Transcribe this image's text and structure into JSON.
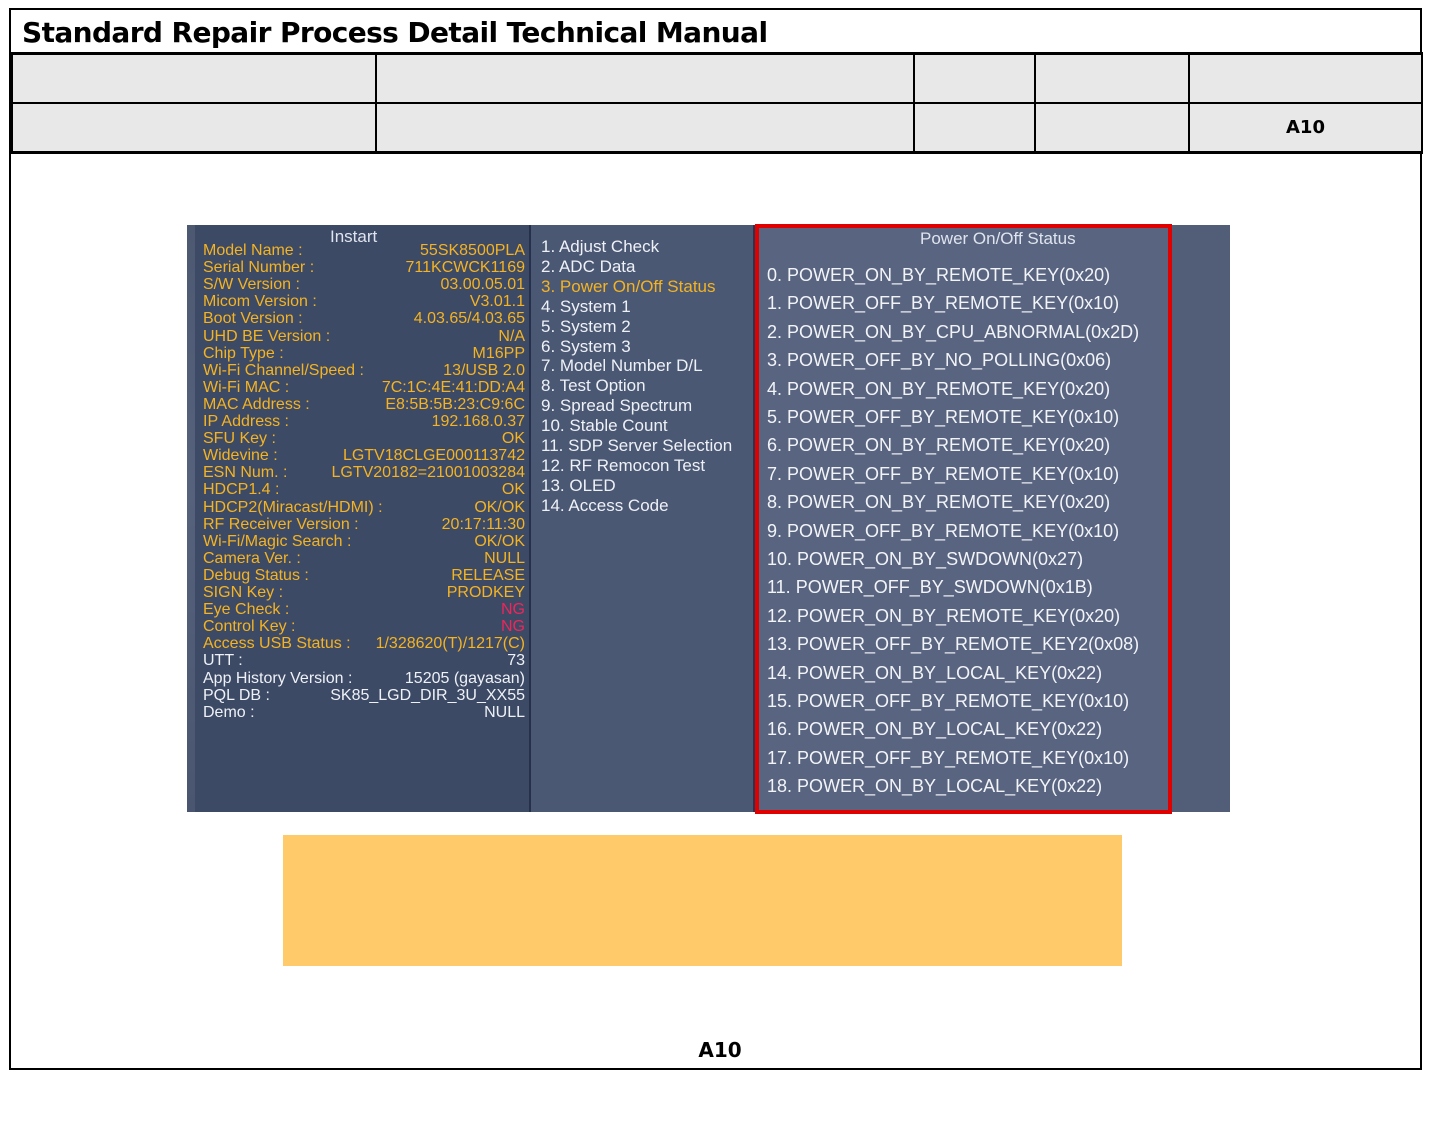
{
  "document": {
    "title": "Standard Repair Process Detail Technical Manual",
    "page_code": "A10",
    "footer_code": "A10"
  },
  "header_table": {
    "row1": [
      "",
      "",
      "",
      "",
      ""
    ],
    "row2": [
      "",
      "",
      "",
      "",
      "A10"
    ]
  },
  "tv": {
    "info_heading": "Instart",
    "info_rows": [
      {
        "label": "Model Name :",
        "value": "55SK8500PLA"
      },
      {
        "label": "Serial Number :",
        "value": "711KCWCK1169"
      },
      {
        "label": "S/W Version :",
        "value": "03.00.05.01"
      },
      {
        "label": "Micom Version :",
        "value": "V3.01.1"
      },
      {
        "label": "Boot Version :",
        "value": "4.03.65/4.03.65"
      },
      {
        "label": "UHD BE Version :",
        "value": "N/A"
      },
      {
        "label": "Chip Type :",
        "value": "M16PP"
      },
      {
        "label": "Wi-Fi Channel/Speed :",
        "value": "13/USB 2.0"
      },
      {
        "label": "Wi-Fi MAC :",
        "value": "7C:1C:4E:41:DD:A4"
      },
      {
        "label": "MAC Address :",
        "value": "E8:5B:5B:23:C9:6C"
      },
      {
        "label": "IP Address :",
        "value": "192.168.0.37"
      },
      {
        "label": "SFU Key :",
        "value": "OK"
      },
      {
        "label": "Widevine :",
        "value": "LGTV18CLGE000113742"
      },
      {
        "label": "ESN Num. :",
        "value": "LGTV20182=21001003284"
      },
      {
        "label": "HDCP1.4 :",
        "value": "OK"
      },
      {
        "label": "HDCP2(Miracast/HDMI) :",
        "value": "OK/OK"
      },
      {
        "label": "RF Receiver Version :",
        "value": "20:17:11:30"
      },
      {
        "label": "Wi-Fi/Magic Search :",
        "value": "OK/OK"
      },
      {
        "label": "Camera Ver. :",
        "value": "NULL"
      },
      {
        "label": "Debug Status :",
        "value": "RELEASE"
      },
      {
        "label": "SIGN Key :",
        "value": "PRODKEY"
      },
      {
        "label": "Eye Check :",
        "value": "NG"
      },
      {
        "label": "Control Key :",
        "value": "NG"
      },
      {
        "label": "Access USB Status :",
        "value": "1/328620(T)/1217(C)"
      },
      {
        "label": "UTT :",
        "value": "73"
      },
      {
        "label": "App History Version :",
        "value": "15205 (gayasan)"
      },
      {
        "label": "PQL DB :",
        "value": "SK85_LGD_DIR_3U_XX55"
      },
      {
        "label": "Demo :",
        "value": "NULL"
      }
    ],
    "menu_items": [
      "1. Adjust Check",
      "2. ADC Data",
      "3. Power On/Off Status",
      "4. System 1",
      "5. System 2",
      "6. System 3",
      "7. Model Number D/L",
      "8. Test Option",
      "9. Spread Spectrum",
      "10. Stable Count",
      "11. SDP Server Selection",
      "12. RF Remocon Test",
      "13. OLED",
      "14. Access Code"
    ],
    "active_menu_index": 2,
    "status_heading": "Power On/Off Status",
    "status_items": [
      "0. POWER_ON_BY_REMOTE_KEY(0x20)",
      "1. POWER_OFF_BY_REMOTE_KEY(0x10)",
      "2. POWER_ON_BY_CPU_ABNORMAL(0x2D)",
      "3. POWER_OFF_BY_NO_POLLING(0x06)",
      "4. POWER_ON_BY_REMOTE_KEY(0x20)",
      "5. POWER_OFF_BY_REMOTE_KEY(0x10)",
      "6. POWER_ON_BY_REMOTE_KEY(0x20)",
      "7. POWER_OFF_BY_REMOTE_KEY(0x10)",
      "8. POWER_ON_BY_REMOTE_KEY(0x20)",
      "9. POWER_OFF_BY_REMOTE_KEY(0x10)",
      "10. POWER_ON_BY_SWDOWN(0x27)",
      "11. POWER_OFF_BY_SWDOWN(0x1B)",
      "12. POWER_ON_BY_REMOTE_KEY(0x20)",
      "13. POWER_OFF_BY_REMOTE_KEY2(0x08)",
      "14. POWER_ON_BY_LOCAL_KEY(0x22)",
      "15. POWER_OFF_BY_REMOTE_KEY(0x10)",
      "16. POWER_ON_BY_LOCAL_KEY(0x22)",
      "17. POWER_OFF_BY_REMOTE_KEY(0x10)",
      "18. POWER_ON_BY_LOCAL_KEY(0x22)"
    ]
  },
  "colors": {
    "highlight_border": "#e00000",
    "note_fill": "#ffca69",
    "info_text": "#f4b322",
    "ng_text": "#f0255a"
  }
}
